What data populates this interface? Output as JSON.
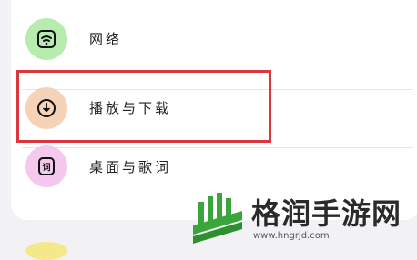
{
  "settings": {
    "items": [
      {
        "label": "网络",
        "icon": "wifi-icon",
        "icon_bg": "#b8ecae"
      },
      {
        "label": "播放与下载",
        "icon": "download-icon",
        "icon_bg": "#f6d3b7"
      },
      {
        "label": "桌面与歌词",
        "icon": "lyrics-icon",
        "icon_bg": "#f5c9ee"
      }
    ]
  },
  "highlight": {
    "color": "#d9363e"
  },
  "watermark": {
    "title": "格润手游网",
    "url": "www.hngrjd.com",
    "logo_color": "#3aa53a"
  }
}
